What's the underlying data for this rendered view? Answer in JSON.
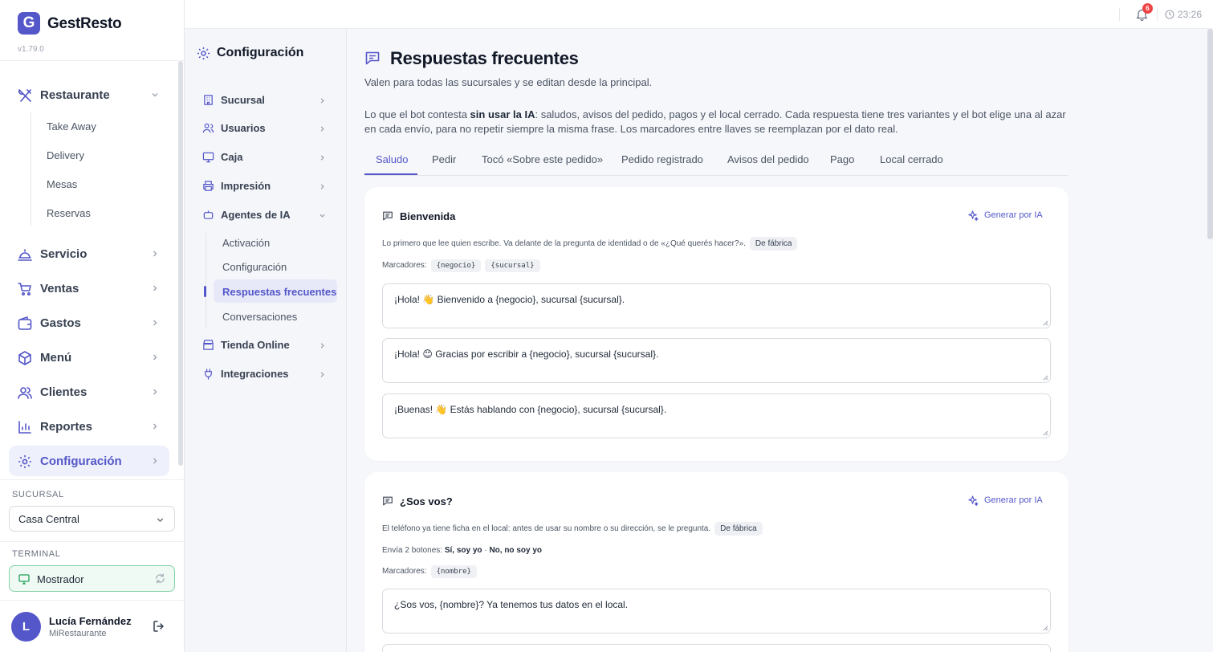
{
  "app": {
    "logo_letter": "G",
    "name": "GestResto",
    "version": "v1.79.0"
  },
  "sidebar": {
    "restaurante": {
      "label": "Restaurante",
      "subitems": [
        "Take Away",
        "Delivery",
        "Mesas",
        "Reservas"
      ]
    },
    "items": [
      {
        "label": "Servicio"
      },
      {
        "label": "Ventas"
      },
      {
        "label": "Gastos"
      },
      {
        "label": "Menú"
      },
      {
        "label": "Clientes"
      },
      {
        "label": "Reportes"
      },
      {
        "label": "Configuración"
      }
    ],
    "sucursal_label": "SUCURSAL",
    "sucursal_value": "Casa Central",
    "terminal_label": "TERMINAL",
    "terminal_value": "Mostrador",
    "user": {
      "initial": "L",
      "name": "Lucía Fernández",
      "org": "MiRestaurante"
    }
  },
  "topbar": {
    "notifications": "6",
    "time": "23:26"
  },
  "config_panel": {
    "title": "Configuración",
    "items": [
      "Sucursal",
      "Usuarios",
      "Caja",
      "Impresión",
      "Agentes de IA",
      "Tienda Online",
      "Integraciones"
    ],
    "agentes_sub": [
      "Activación",
      "Configuración",
      "Respuestas frecuentes",
      "Conversaciones"
    ]
  },
  "page": {
    "title": "Respuestas frecuentes",
    "subtitle": "Valen para todas las sucursales y se editan desde la principal.",
    "desc_pre": "Lo que el bot contesta ",
    "desc_bold": "sin usar la IA",
    "desc_post": ": saludos, avisos del pedido, pagos y el local cerrado. Cada respuesta tiene tres variantes y el bot elige una al azar en cada envío, para no repetir siempre la misma frase. Los marcadores entre llaves se reemplazan por el dato real.",
    "tabs": [
      "Saludo",
      "Pedir",
      "Tocó «Sobre este pedido»",
      "Pedido registrado",
      "Avisos del pedido",
      "Pago",
      "Local cerrado"
    ],
    "active_tab": "Saludo"
  },
  "cards": [
    {
      "title": "Bienvenida",
      "generate_label": "Generar por IA",
      "desc": "Lo primero que lee quien escribe. Va delante de la pregunta de identidad o de «¿Qué querés hacer?».",
      "badge": "De fábrica",
      "markers_label": "Marcadores:",
      "markers": [
        "{negocio}",
        "{sucursal}"
      ],
      "variants": [
        "¡Hola! 👋 Bienvenido a {negocio}, sucursal {sucursal}.",
        "¡Hola! 😊 Gracias por escribir a {negocio}, sucursal {sucursal}.",
        "¡Buenas! 👋 Estás hablando con {negocio}, sucursal {sucursal}."
      ]
    },
    {
      "title": "¿Sos vos?",
      "generate_label": "Generar por IA",
      "desc": "El teléfono ya tiene ficha en el local: antes de usar su nombre o su dirección, se le pregunta.",
      "badge": "De fábrica",
      "buttons_label": "Envía 2 botones:",
      "button_1": "Sí, soy yo",
      "button_sep": "·",
      "button_2": "No, no soy yo",
      "markers_label": "Marcadores:",
      "markers": [
        "{nombre}"
      ],
      "variants": [
        "¿Sos vos, {nombre}? Ya tenemos tus datos en el local."
      ]
    }
  ],
  "colors": {
    "accent": "#5457c9",
    "badge_red": "#ef4444",
    "terminal_green": "#86d1a9"
  }
}
